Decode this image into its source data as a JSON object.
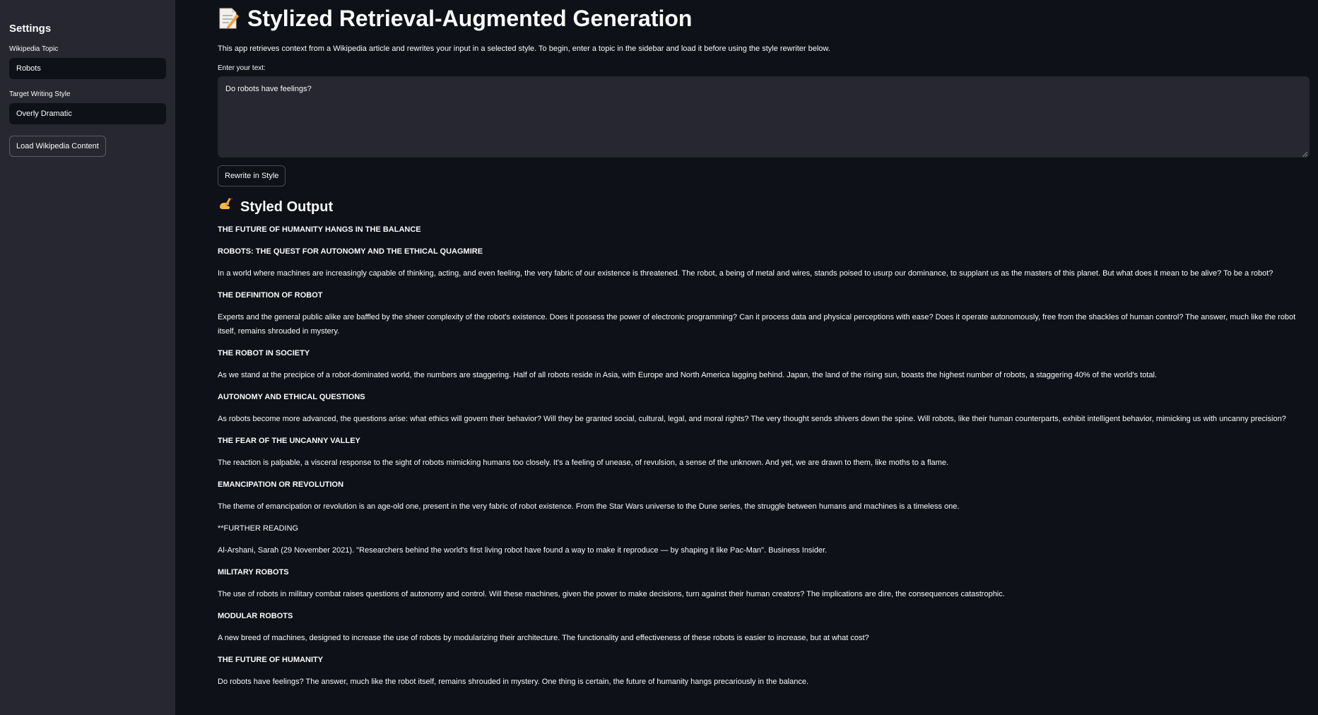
{
  "sidebar": {
    "title": "Settings",
    "topic_label": "Wikipedia Topic",
    "topic_value": "Robots",
    "style_label": "Target Writing Style",
    "style_value": "Overly Dramatic",
    "load_button": "Load Wikipedia Content"
  },
  "main": {
    "title": "Stylized Retrieval-Augmented Generation",
    "title_icon": "memo-icon",
    "intro": "This app retrieves context from a Wikipedia article and rewrites your input in a selected style. To begin, enter a topic in the sidebar and load it before using the style rewriter below.",
    "input_label": "Enter your text:",
    "input_value": "Do robots have feelings?",
    "rewrite_button": "Rewrite in Style",
    "output_title": "Styled Output",
    "output_icon": "writing-hand-icon"
  },
  "output": [
    {
      "type": "heading",
      "text": "THE FUTURE OF HUMANITY HANGS IN THE BALANCE"
    },
    {
      "type": "heading",
      "text": "ROBOTS: THE QUEST FOR AUTONOMY AND THE ETHICAL QUAGMIRE"
    },
    {
      "type": "para",
      "text": "In a world where machines are increasingly capable of thinking, acting, and even feeling, the very fabric of our existence is threatened. The robot, a being of metal and wires, stands poised to usurp our dominance, to supplant us as the masters of this planet. But what does it mean to be alive? To be a robot?"
    },
    {
      "type": "heading",
      "text": "THE DEFINITION OF ROBOT"
    },
    {
      "type": "para",
      "text": "Experts and the general public alike are baffled by the sheer complexity of the robot's existence. Does it possess the power of electronic programming? Can it process data and physical perceptions with ease? Does it operate autonomously, free from the shackles of human control? The answer, much like the robot itself, remains shrouded in mystery."
    },
    {
      "type": "heading",
      "text": "THE ROBOT IN SOCIETY"
    },
    {
      "type": "para",
      "text": "As we stand at the precipice of a robot-dominated world, the numbers are staggering. Half of all robots reside in Asia, with Europe and North America lagging behind. Japan, the land of the rising sun, boasts the highest number of robots, a staggering 40% of the world's total."
    },
    {
      "type": "heading",
      "text": "AUTONOMY AND ETHICAL QUESTIONS"
    },
    {
      "type": "para",
      "text": "As robots become more advanced, the questions arise: what ethics will govern their behavior? Will they be granted social, cultural, legal, and moral rights? The very thought sends shivers down the spine. Will robots, like their human counterparts, exhibit intelligent behavior, mimicking us with uncanny precision?"
    },
    {
      "type": "heading",
      "text": "THE FEAR OF THE UNCANNY VALLEY"
    },
    {
      "type": "para",
      "text": "The reaction is palpable, a visceral response to the sight of robots mimicking humans too closely. It's a feeling of unease, of revulsion, a sense of the unknown. And yet, we are drawn to them, like moths to a flame."
    },
    {
      "type": "heading",
      "text": "EMANCIPATION OR REVOLUTION"
    },
    {
      "type": "para",
      "text": "The theme of emancipation or revolution is an age-old one, present in the very fabric of robot existence. From the Star Wars universe to the Dune series, the struggle between humans and machines is a timeless one."
    },
    {
      "type": "para",
      "text": "**FURTHER READING"
    },
    {
      "type": "para",
      "text": "Al-Arshani, Sarah (29 November 2021). \"Researchers behind the world's first living robot have found a way to make it reproduce — by shaping it like Pac-Man\". Business Insider."
    },
    {
      "type": "heading",
      "text": "MILITARY ROBOTS"
    },
    {
      "type": "para",
      "text": "The use of robots in military combat raises questions of autonomy and control. Will these machines, given the power to make decisions, turn against their human creators? The implications are dire, the consequences catastrophic."
    },
    {
      "type": "heading",
      "text": "MODULAR ROBOTS"
    },
    {
      "type": "para",
      "text": "A new breed of machines, designed to increase the use of robots by modularizing their architecture. The functionality and effectiveness of these robots is easier to increase, but at what cost?"
    },
    {
      "type": "heading",
      "text": "THE FUTURE OF HUMANITY"
    },
    {
      "type": "para",
      "text": "Do robots have feelings? The answer, much like the robot itself, remains shrouded in mystery. One thing is certain, the future of humanity hangs precariously in the balance."
    }
  ]
}
